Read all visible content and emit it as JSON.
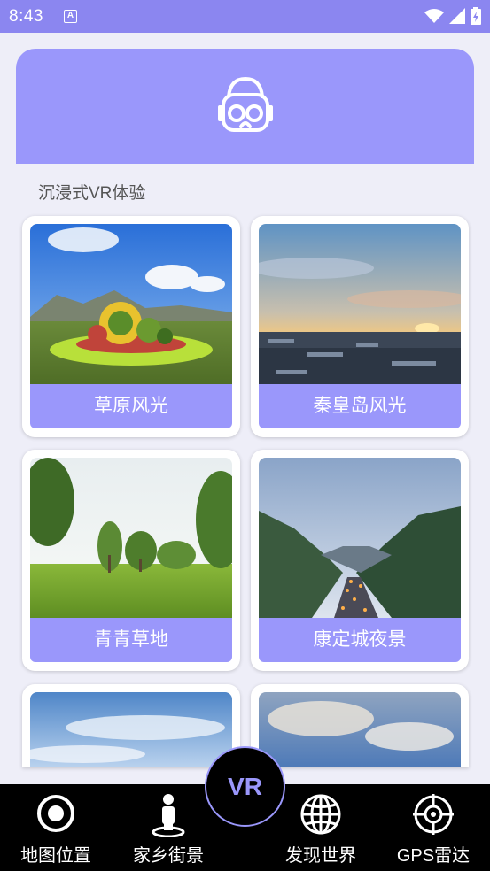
{
  "status_bar": {
    "time": "8:43",
    "badge": "A"
  },
  "section_title": "沉浸式VR体验",
  "cards": [
    {
      "label": "草原风光"
    },
    {
      "label": "秦皇岛风光"
    },
    {
      "label": "青青草地"
    },
    {
      "label": "康定城夜景"
    },
    {
      "label": ""
    },
    {
      "label": ""
    }
  ],
  "nav": {
    "items": [
      {
        "label": "地图位置",
        "icon": "target-icon"
      },
      {
        "label": "家乡街景",
        "icon": "person-pin-icon"
      },
      {
        "label": "发现世界",
        "icon": "globe-icon"
      },
      {
        "label": "GPS雷达",
        "icon": "radar-icon"
      }
    ],
    "center": "VR"
  },
  "colors": {
    "accent": "#9a97fb",
    "status_bar": "#8b86f0",
    "nav_bg": "#000000"
  }
}
